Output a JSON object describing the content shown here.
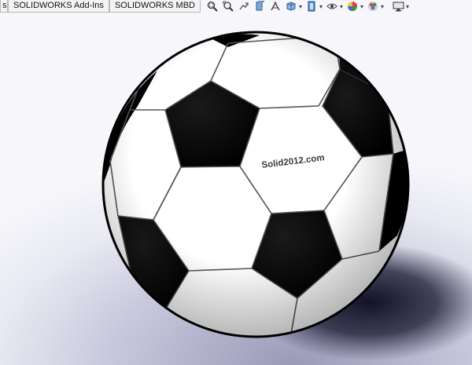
{
  "command_manager": {
    "tabs": [
      {
        "label": "s"
      },
      {
        "label": "SOLIDWORKS Add-Ins"
      },
      {
        "label": "SOLIDWORKS MBD"
      }
    ],
    "view_toolbar_icons": [
      "zoom-to-fit-icon",
      "zoom-to-area-icon",
      "previous-view-icon",
      "section-view-icon",
      "dynamic-annotation-icon",
      "view-orientation-icon",
      "display-style-icon",
      "hide-show-items-icon",
      "edit-appearance-icon",
      "apply-scene-icon",
      "view-settings-icon"
    ]
  },
  "graphics_area": {
    "watermark": "Solid2012.com",
    "model": "soccer-ball",
    "colors": {
      "panel_white": "#ffffff",
      "panel_black": "#000000",
      "seam": "#555555",
      "background_top": "#f7f7fb",
      "background_bottom": "#9a9ab8"
    }
  }
}
